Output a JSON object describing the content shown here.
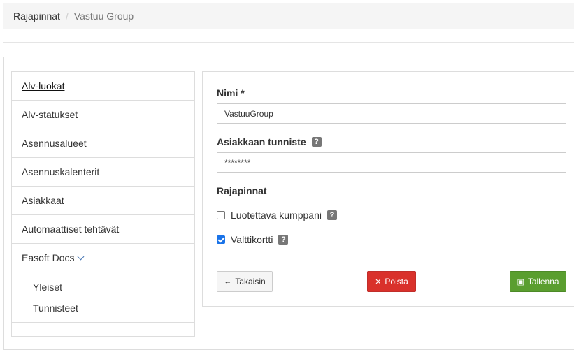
{
  "breadcrumb": {
    "root": "Rajapinnat",
    "separator": "/",
    "current": "Vastuu Group"
  },
  "menu": {
    "items": [
      "Alv-luokat",
      "Alv-statukset",
      "Asennusalueet",
      "Asennuskalenterit",
      "Asiakkaat",
      "Automaattiset tehtävät",
      "Easoft Docs"
    ],
    "sub_items": [
      "Yleiset",
      "Tunnisteet"
    ]
  },
  "form": {
    "name_label": "Nimi *",
    "name_value": "VastuuGroup",
    "customer_id_label": "Asiakkaan tunniste",
    "customer_id_value": "********",
    "interfaces_label": "Rajapinnat",
    "trusted_partner_label": "Luotettava kumppani",
    "trusted_partner_checked": false,
    "valttikortti_label": "Valttikortti",
    "valttikortti_checked": true,
    "help_glyph": "?"
  },
  "buttons": {
    "back": "Takaisin",
    "delete": "Poista",
    "save": "Tallenna"
  },
  "colors": {
    "delete": "#d9312b",
    "save": "#5a9e2f",
    "checkbox": "#1a73e8"
  }
}
